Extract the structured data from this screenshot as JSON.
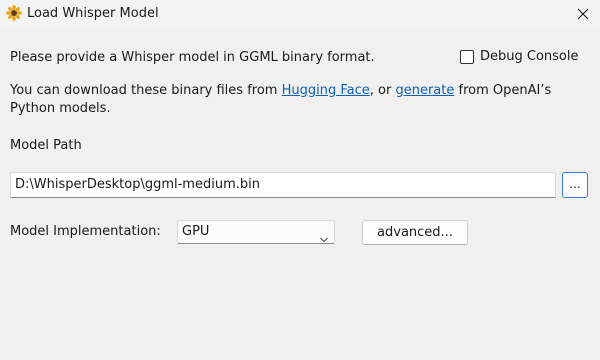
{
  "window": {
    "title": "Load Whisper Model",
    "icon": "sunflower-icon",
    "close_icon": "close-icon"
  },
  "intro": {
    "line1": "Please provide a Whisper model in GGML binary format.",
    "download_prefix": "You can download these binary files from ",
    "hugging_face_link": "Hugging Face",
    "download_middle": ", or ",
    "generate_link": "generate",
    "download_suffix": " from OpenAI’s",
    "download_line2": "Python models."
  },
  "debug_console": {
    "label": "Debug Console",
    "checked": false
  },
  "model_path": {
    "label": "Model Path",
    "value": "D:\\WhisperDesktop\\ggml-medium.bin",
    "browse_label": "..."
  },
  "implementation": {
    "label": "Model Implementation:",
    "selected": "GPU",
    "advanced_label": "advanced..."
  },
  "colors": {
    "link": "#0f5fb8",
    "background": "#f0f0f0",
    "focus_border": "#3a7bd5"
  }
}
